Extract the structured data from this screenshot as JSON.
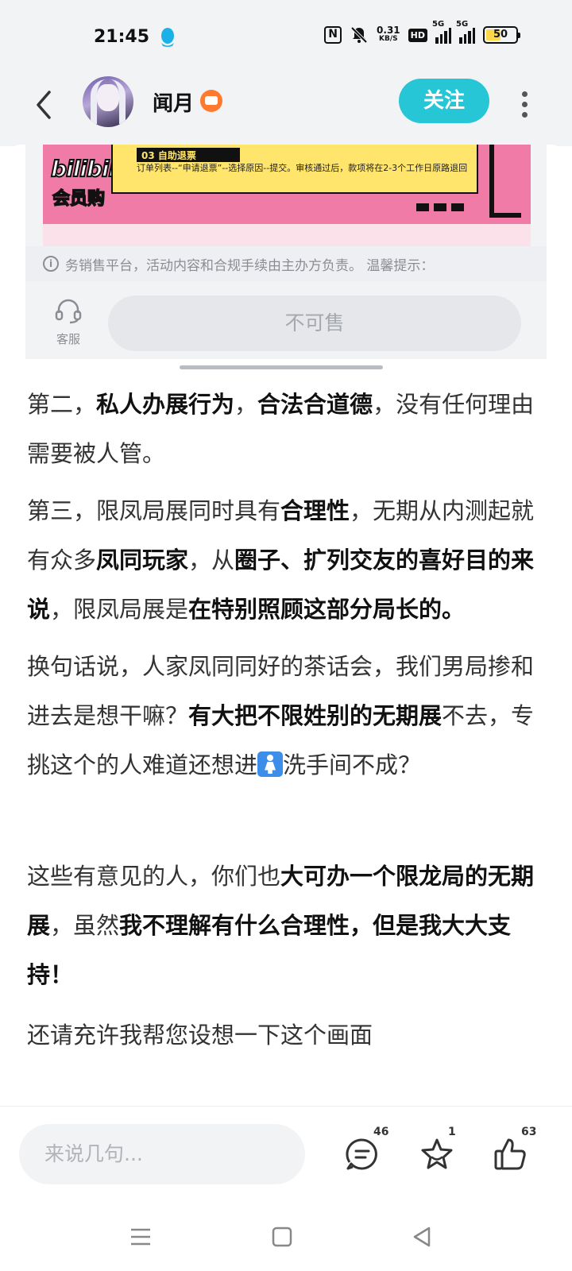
{
  "status_bar": {
    "time": "21:45",
    "net_speed_value": "0.31",
    "net_speed_unit": "KB/S",
    "hd_label": "HD",
    "signal1": "5G",
    "signal2": "5G",
    "battery": "50",
    "icons": [
      "qq-icon",
      "nfc-icon",
      "mute-icon",
      "signal-icon",
      "battery-icon"
    ]
  },
  "header": {
    "username": "闻月",
    "follow_label": "关注"
  },
  "embed": {
    "logo_line1": "bilibili",
    "logo_line2": "会员购",
    "step_title": "03 自助退票",
    "step_text": "订单列表--“申请退票”--选择原因--提交。审核通过后，款项将在2-3个工作日原路退回",
    "notice": "务销售平台，活动内容和合规手续由主办方负责。 温馨提示：",
    "service_label": "客服",
    "not_sale_label": "不可售"
  },
  "article": {
    "p1": [
      {
        "t": "第二，",
        "b": false
      },
      {
        "t": "私人办展行为",
        "b": true
      },
      {
        "t": "，",
        "b": false
      },
      {
        "t": "合法合道德",
        "b": true
      },
      {
        "t": "，没有任何理由需要被人管。",
        "b": false
      }
    ],
    "p2": [
      {
        "t": "第三，限凤局展同时具有",
        "b": false
      },
      {
        "t": "合理性",
        "b": true
      },
      {
        "t": "，无期从内测起就有众多",
        "b": false
      },
      {
        "t": "凤同玩家",
        "b": true
      },
      {
        "t": "，从",
        "b": false
      },
      {
        "t": "圈子、扩列交友的喜好目的来说",
        "b": true
      },
      {
        "t": "，限凤局展是",
        "b": false
      },
      {
        "t": "在特别照顾这部分局长的。",
        "b": true
      }
    ],
    "p3_a": "换句话说，人家凤同同好的茶话会，我们男局掺和进去是想干嘛？",
    "p3_b": "有大把不限姓别的无期展",
    "p3_c": "不去，专挑这个的人难道还想进",
    "p3_d": "洗手间不成？",
    "p4": [
      {
        "t": "这些有意见的人，你们也",
        "b": false
      },
      {
        "t": "大可办一个限龙局的无期展",
        "b": true
      },
      {
        "t": "，虽然",
        "b": false
      },
      {
        "t": "我不理解有什么合理性，但是我大大支持！",
        "b": true
      }
    ],
    "p5_partial": "还请充许我帮您设想一下这个画面"
  },
  "bottom_bar": {
    "comment_placeholder": "来说几句...",
    "comment_count": "46",
    "favorite_count": "1",
    "like_count": "63"
  }
}
